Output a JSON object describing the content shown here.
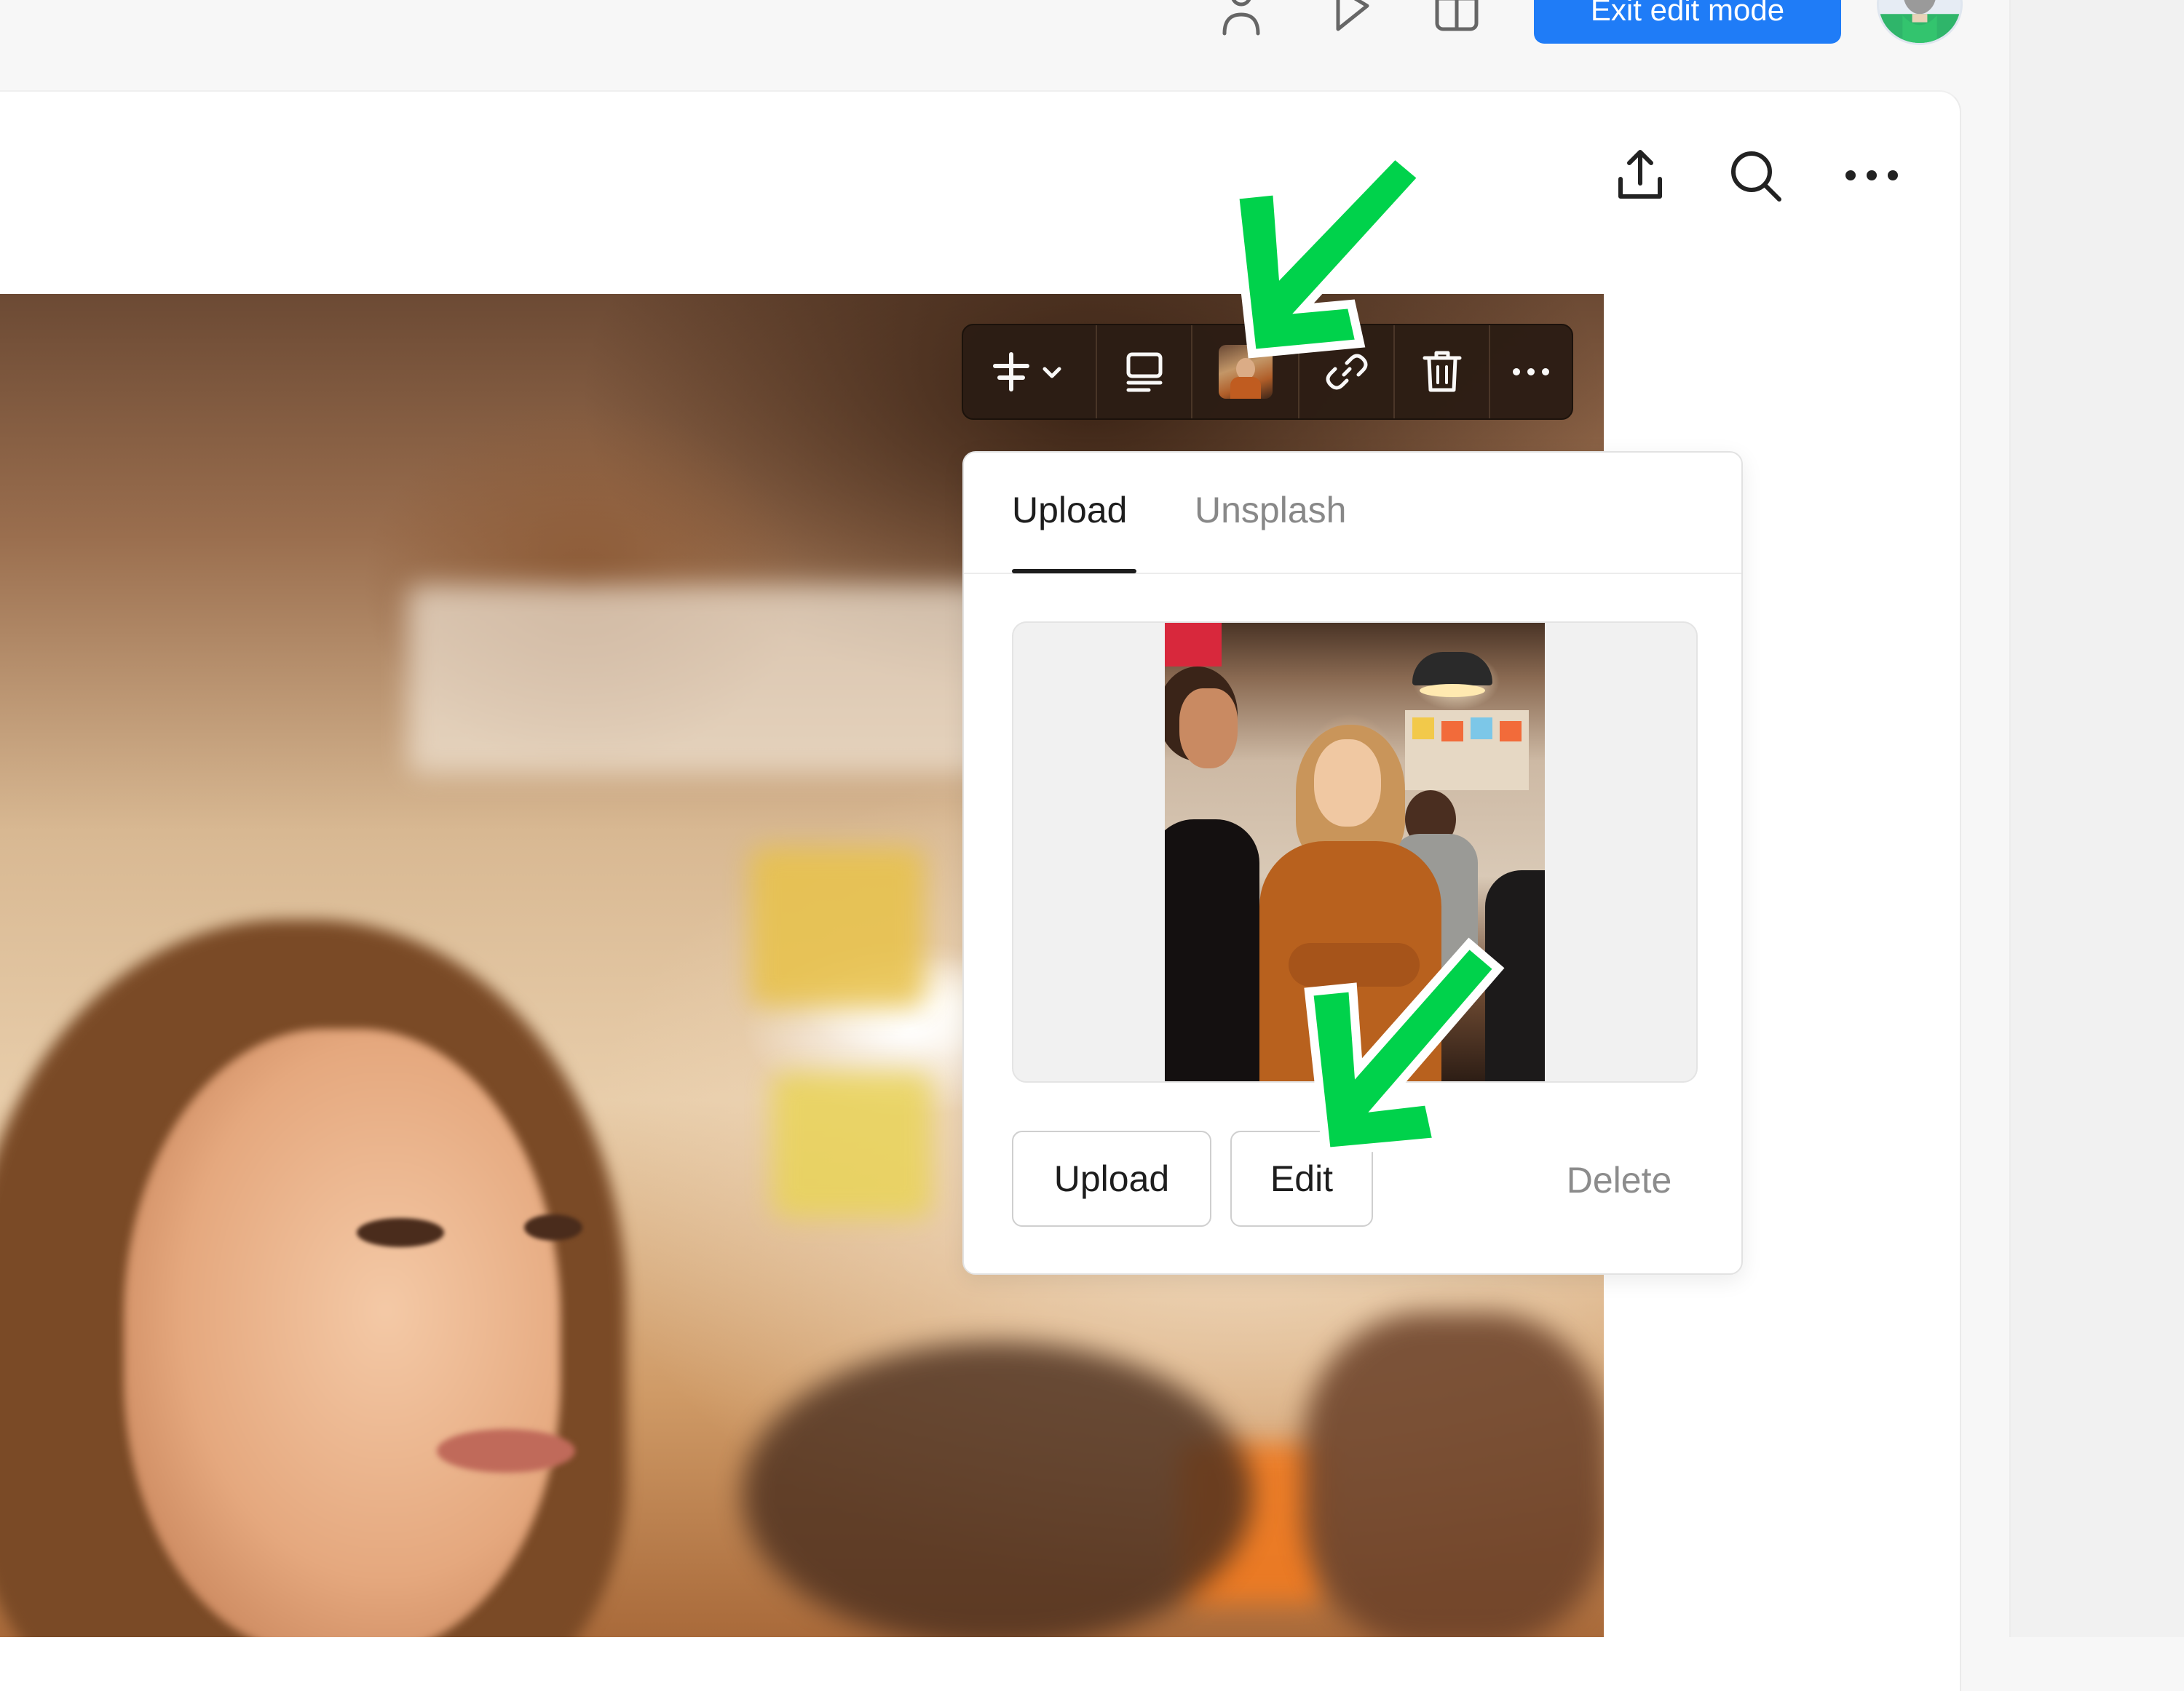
{
  "topbar": {
    "exit_edit_mode_label": "Exit edit mode"
  },
  "toolbar": {
    "icons": [
      "align-icon",
      "chevron-down-icon",
      "caption-layout-icon",
      "image-thumbnail",
      "link-icon",
      "trash-icon",
      "more-icon"
    ]
  },
  "popover": {
    "tabs": [
      {
        "label": "Upload",
        "active": true
      },
      {
        "label": "Unsplash",
        "active": false
      }
    ],
    "buttons": {
      "upload": "Upload",
      "edit": "Edit",
      "delete": "Delete"
    }
  },
  "colors": {
    "primary": "#1f7cf7",
    "annotation_arrow": "#00d24b",
    "toolbar_bg": "#2c1d14"
  }
}
